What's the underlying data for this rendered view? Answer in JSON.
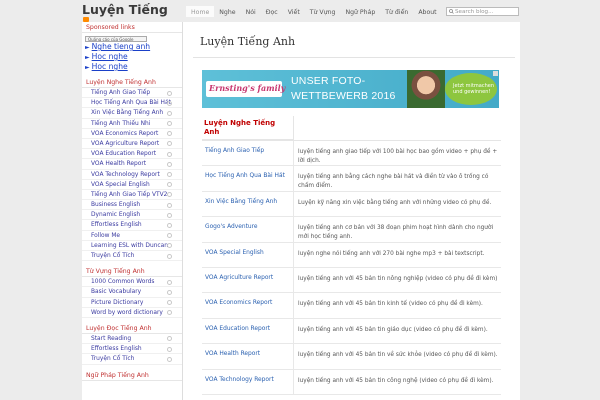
{
  "site": {
    "title": "Luyện Tiếng"
  },
  "nav": [
    "Home",
    "Nghe",
    "Nói",
    "Đọc",
    "Viết",
    "Từ Vựng",
    "Ngữ Pháp",
    "Từ điển",
    "About"
  ],
  "search": {
    "placeholder": "Search blog..."
  },
  "sidebar": {
    "sponsored_title": "Sponsored links",
    "adchoices": "Quảng cáo của Google",
    "ad_links": [
      "Nghe tieng anh",
      "Hoc nghe",
      "Hoc nghe"
    ],
    "sections": [
      {
        "title": "Luyện Nghe Tiếng Anh",
        "items": [
          "Tiếng Anh Giao Tiếp",
          "Học Tiếng Anh Qua Bài Hát",
          "Xin Việc Bằng Tiếng Anh",
          "Tiếng Anh Thiếu Nhi",
          "VOA Economics Report",
          "VOA Agriculture Report",
          "VOA Education Report",
          "VOA Health Report",
          "VOA Technology Report",
          "VOA Special English",
          "Tiếng Anh Giao Tiếp VTV2",
          "Business English",
          "Dynamic English",
          "Effortless English",
          "Follow Me",
          "Learning ESL with Duncan",
          "Truyện Cổ Tích"
        ]
      },
      {
        "title": "Từ Vựng Tiếng Anh",
        "items": [
          "1000 Common Words",
          "Basic Vocabulary",
          "Picture Dictionary",
          "Word by word dictionary"
        ]
      },
      {
        "title": "Luyện Đọc Tiếng Anh",
        "items": [
          "Start Reading",
          "Effortless English",
          "Truyện Cổ Tích"
        ]
      },
      {
        "title": "Ngữ Pháp Tiếng Anh",
        "items": []
      }
    ]
  },
  "main": {
    "title": "Luyện Tiếng Anh",
    "banner": {
      "brand": "Ernsting's family",
      "line1": "UNSER FOTO-",
      "line2": "WETTBEWERB 2016",
      "bubble1": "Jetzt mitmachen",
      "bubble2": "und gewinnen!"
    },
    "table_header": "Luyện Nghe Tiếng Anh",
    "rows": [
      {
        "name": "Tiếng Anh Giao Tiếp",
        "desc": "luyện tiếng anh giao tiếp với 100 bài học bao gồm video + phụ đề + lời dịch."
      },
      {
        "name": "Học Tiếng Anh Qua Bài Hát",
        "desc": "luyện tiếng anh bằng cách nghe bài hát và điền từ vào ô trống có chấm điểm."
      },
      {
        "name": "Xin Việc Bằng Tiếng Anh",
        "desc": "Luyện kỹ năng xin việc bằng tiếng anh với những video có phụ đề."
      },
      {
        "name": "Gogo's Adventure",
        "desc": "luyện tiếng anh cơ bản với 38 đoạn phim hoạt hình dành cho người mới học tiếng anh."
      },
      {
        "name": "VOA Special English",
        "desc": "luyện nghe nói tiếng anh với 270 bài nghe mp3 + bài textscript."
      },
      {
        "name": "VOA Agriculture Report",
        "desc": "luyện tiếng anh với 45 bản tin nông nghiệp (video có phụ đề đi kèm)"
      },
      {
        "name": "VOA Economics Report",
        "desc": "luyện tiếng anh với 45 bản tin kinh tế (video có phụ đề đi kèm)."
      },
      {
        "name": "VOA Education Report",
        "desc": "luyện tiếng anh với 45 bản tin giáo dục (video có phụ đề đi kèm)."
      },
      {
        "name": "VOA Health Report",
        "desc": "luyện tiếng anh với 45 bản tin về sức khỏe (video có phụ đề đi kèm)."
      },
      {
        "name": "VOA Technology Report",
        "desc": "luyện tiếng anh với 45 bản tin công nghệ (video có phụ đề đi kèm)."
      }
    ]
  },
  "colors": {
    "accent": "#c03030",
    "link": "#2a60b0",
    "banner": "#4fb6d0"
  }
}
